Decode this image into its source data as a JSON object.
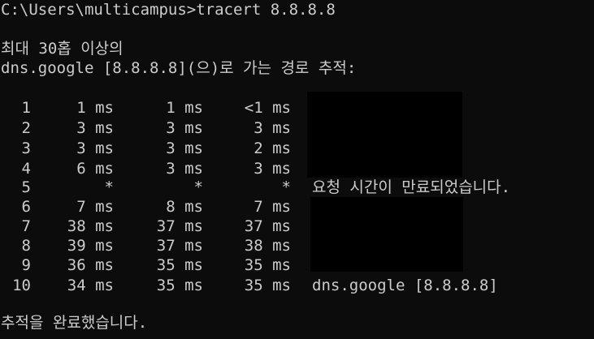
{
  "prompt_line": "C:\\Users\\multicampus>tracert 8.8.8.8",
  "header_line_1": "최대 30홉 이상의",
  "header_line_2": "dns.google [8.8.8.8](으)로 가는 경로 추적:",
  "hops": [
    {
      "hop": "1",
      "r1": "1 ms",
      "r2": "1 ms",
      "r3": "<1 ms",
      "host": ""
    },
    {
      "hop": "2",
      "r1": "3 ms",
      "r2": "3 ms",
      "r3": "3 ms",
      "host": ""
    },
    {
      "hop": "3",
      "r1": "3 ms",
      "r2": "3 ms",
      "r3": "2 ms",
      "host": ""
    },
    {
      "hop": "4",
      "r1": "6 ms",
      "r2": "3 ms",
      "r3": "3 ms",
      "host": ""
    },
    {
      "hop": "5",
      "r1": "*",
      "r2": "*",
      "r3": "*",
      "host": "요청 시간이 만료되었습니다."
    },
    {
      "hop": "6",
      "r1": "7 ms",
      "r2": "8 ms",
      "r3": "7 ms",
      "host": ""
    },
    {
      "hop": "7",
      "r1": "38 ms",
      "r2": "37 ms",
      "r3": "37 ms",
      "host": ""
    },
    {
      "hop": "8",
      "r1": "39 ms",
      "r2": "37 ms",
      "r3": "38 ms",
      "host": ""
    },
    {
      "hop": "9",
      "r1": "36 ms",
      "r2": "35 ms",
      "r3": "35 ms",
      "host": ""
    },
    {
      "hop": "10",
      "r1": "34 ms",
      "r2": "35 ms",
      "r3": "35 ms",
      "host": "dns.google [8.8.8.8]"
    }
  ],
  "footer_line": "추적을 완료했습니다.",
  "colors": {
    "background": "#0c0c0c",
    "text": "#cccccc",
    "redaction": "#000000"
  }
}
